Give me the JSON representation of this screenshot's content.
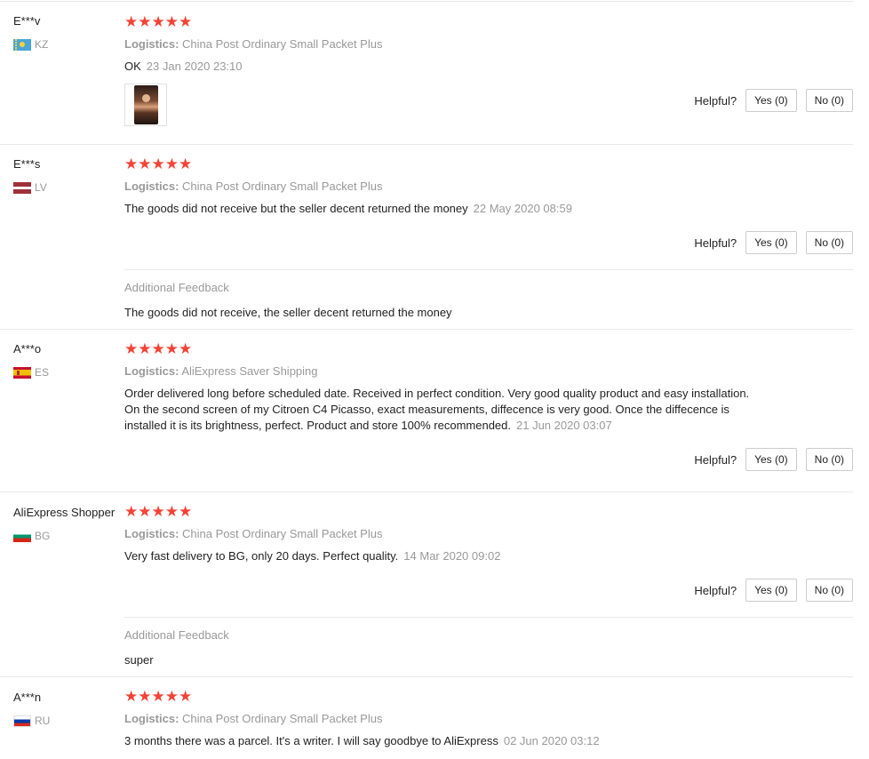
{
  "helpful_label": "Helpful?",
  "reviews": [
    {
      "user": "E***v",
      "country": "KZ",
      "stars": "★★★★★",
      "logistics_label": "Logistics:",
      "logistics": "China Post Ordinary Small Packet Plus",
      "text": "OK",
      "date": "23 Jan 2020 23:10",
      "yes": "Yes (0)",
      "no": "No (0)",
      "has_photo": true
    },
    {
      "user": "E***s",
      "country": "LV",
      "stars": "★★★★★",
      "logistics_label": "Logistics:",
      "logistics": "China Post Ordinary Small Packet Plus",
      "text": "The goods did not receive but the seller decent returned the money",
      "date": "22 May 2020 08:59",
      "yes": "Yes (0)",
      "no": "No (0)",
      "additional_title": "Additional Feedback",
      "additional_text": "The goods did not receive, the seller decent returned the money"
    },
    {
      "user": "A***o",
      "country": "ES",
      "stars": "★★★★★",
      "logistics_label": "Logistics:",
      "logistics": "AliExpress Saver Shipping",
      "text": "Order delivered long before scheduled date. Received in perfect condition. Very good quality product and easy installation. On the second screen of my Citroen C4 Picasso, exact measurements, diffecence is very good. Once the diffecence is installed it is its brightness, perfect. Product and store 100% recommended.",
      "date": "21 Jun 2020 03:07",
      "yes": "Yes (0)",
      "no": "No (0)"
    },
    {
      "user": "AliExpress Shopper",
      "country": "BG",
      "stars": "★★★★★",
      "logistics_label": "Logistics:",
      "logistics": "China Post Ordinary Small Packet Plus",
      "text": "Very fast delivery to BG, only 20 days. Perfect quality.",
      "date": "14 Mar 2020 09:02",
      "yes": "Yes (0)",
      "no": "No (0)",
      "additional_title": "Additional Feedback",
      "additional_text": "super"
    },
    {
      "user": "A***n",
      "country": "RU",
      "stars": "★★★★★",
      "logistics_label": "Logistics:",
      "logistics": "China Post Ordinary Small Packet Plus",
      "text": "3 months there was a parcel. It's a writer. I will say goodbye to AliExpress",
      "date": "02 Jun 2020 03:12"
    }
  ]
}
